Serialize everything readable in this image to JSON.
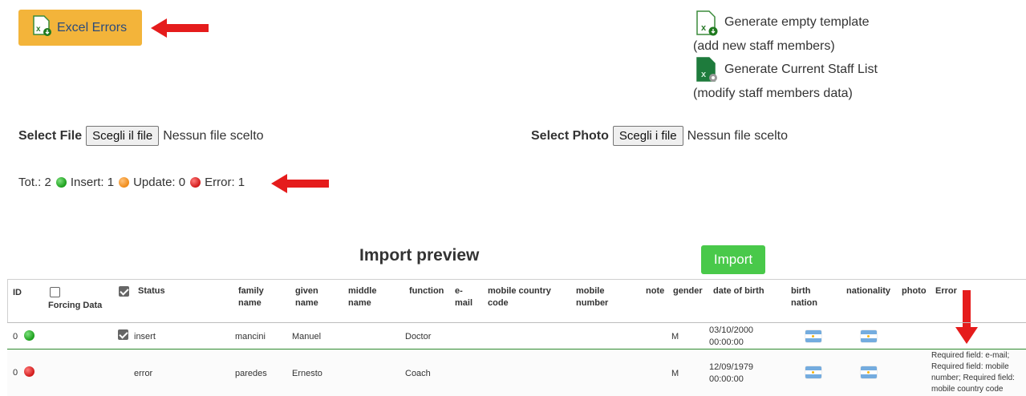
{
  "toolbar": {
    "excel_errors_label": "Excel Errors"
  },
  "templates": {
    "empty_label": "Generate empty template",
    "empty_sub": "(add new staff members)",
    "current_label": "Generate Current Staff List",
    "current_sub": "(modify staff members data)"
  },
  "file_select": {
    "label": "Select File",
    "button": "Scegli il file",
    "status": "Nessun file scelto"
  },
  "photo_select": {
    "label": "Select Photo",
    "button": "Scegli i file",
    "status": "Nessun file scelto"
  },
  "summary": {
    "tot_label": "Tot.: 2",
    "insert_label": "Insert: 1",
    "update_label": "Update: 0",
    "error_label": "Error: 1"
  },
  "preview": {
    "title": "Import preview",
    "import_button": "Import"
  },
  "table": {
    "headers": {
      "id": "ID",
      "forcing": "Forcing Data",
      "status": "Status",
      "family_name": "family name",
      "given_name": "given name",
      "middle_name": "middle name",
      "function": "function",
      "email": "e-mail",
      "mobile_country_code": "mobile country code",
      "mobile_number": "mobile number",
      "note": "note",
      "gender": "gender",
      "date_of_birth": "date of birth",
      "birth_nation": "birth nation",
      "nationality": "nationality",
      "photo": "photo",
      "error": "Error"
    },
    "rows": [
      {
        "id": "0",
        "status_color": "#1a9e1a",
        "forcing_checked": false,
        "status_checked": true,
        "status": "insert",
        "family_name": "mancini",
        "given_name": "Manuel",
        "middle_name": "",
        "function": "Doctor",
        "email": "",
        "mobile_country_code": "",
        "mobile_number": "",
        "note": "",
        "gender": "M",
        "date_of_birth": "03/10/2000 00:00:00",
        "birth_nation_icon": "argentina-flag-icon",
        "nationality_icon": "argentina-flag-icon",
        "error": ""
      },
      {
        "id": "0",
        "status_color": "#d01818",
        "forcing_checked": false,
        "status_checked": false,
        "status": "error",
        "family_name": "paredes",
        "given_name": "Ernesto",
        "middle_name": "",
        "function": "Coach",
        "email": "",
        "mobile_country_code": "",
        "mobile_number": "",
        "note": "",
        "gender": "M",
        "date_of_birth": "12/09/1979 00:00:00",
        "birth_nation_icon": "argentina-flag-icon",
        "nationality_icon": "argentina-flag-icon",
        "error": "Required field: e-mail; Required field: mobile number; Required field: mobile country code"
      }
    ]
  },
  "colors": {
    "accent_button": "#f3b43a",
    "import_button": "#49c94a",
    "annotation_arrow": "#e51c1c"
  }
}
